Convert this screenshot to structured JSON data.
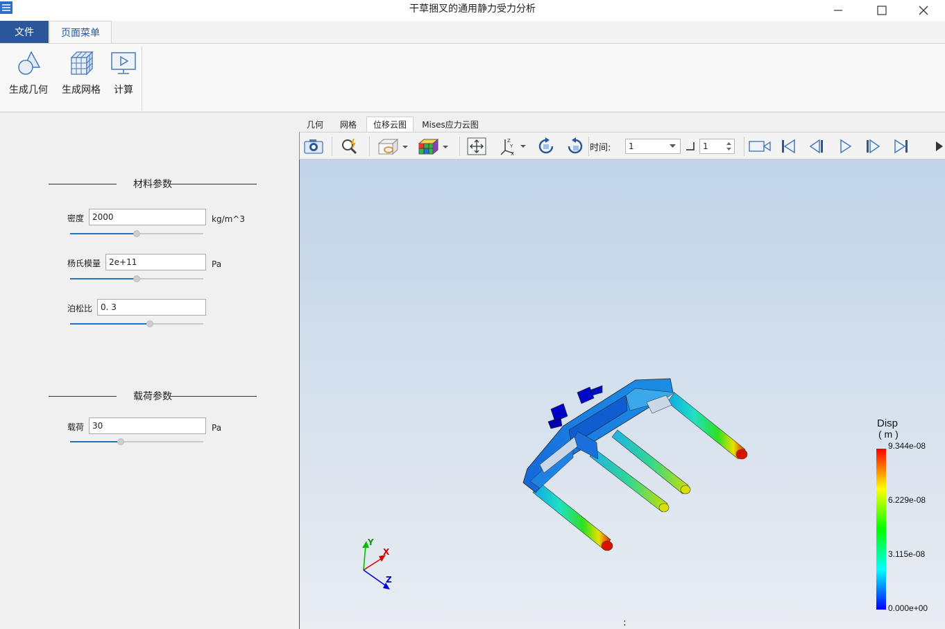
{
  "window": {
    "title": "干草捆叉的通用静力受力分析",
    "app_icon": "app-logo-icon",
    "controls": [
      "minimize-icon",
      "maximize-icon",
      "close-icon"
    ]
  },
  "ribbon": {
    "tabs": [
      {
        "label": "文件",
        "active": false
      },
      {
        "label": "页面菜单",
        "active": true
      }
    ],
    "buttons": [
      {
        "label": "生成几何",
        "icon": "geometry-icon"
      },
      {
        "label": "生成网格",
        "icon": "mesh-icon"
      },
      {
        "label": "计算",
        "icon": "compute-icon"
      }
    ]
  },
  "material_section": {
    "title": "材料参数",
    "params": [
      {
        "label": "密度",
        "value": "2000",
        "unit": "kg/m^3",
        "slider_fraction": 0.5
      },
      {
        "label": "杨氏模量",
        "value": "2e+11",
        "unit": "Pa",
        "slider_fraction": 0.5
      },
      {
        "label": "泊松比",
        "value": "0. 3",
        "unit": "",
        "slider_fraction": 0.6
      }
    ]
  },
  "load_section": {
    "title": "载荷参数",
    "params": [
      {
        "label": "载荷",
        "value": "30",
        "unit": "Pa",
        "slider_fraction": 0.38
      }
    ]
  },
  "viewer": {
    "tabs": [
      {
        "label": "几何",
        "active": false
      },
      {
        "label": "网格",
        "active": false
      },
      {
        "label": "位移云图",
        "active": true
      },
      {
        "label": "Mises应力云图",
        "active": false
      }
    ],
    "toolbar": {
      "time_label": "时间:",
      "time_value": "1",
      "step_value": "1",
      "icons": [
        "camera-icon",
        "zoom-icon",
        "view-box-icon",
        "colormap-cube-icon",
        "pan-icon",
        "axes-icon",
        "rotate-cw-icon",
        "rotate-ccw-icon",
        "record-icon",
        "first-frame-icon",
        "prev-frame-icon",
        "play-icon",
        "next-frame-icon",
        "last-frame-icon"
      ]
    },
    "legend": {
      "title_line1": "Disp",
      "title_line2": "( m )",
      "max": "9.344e-08",
      "v2": "6.229e-08",
      "v1": "3.115e-08",
      "min": "0.000e+00",
      "colors": [
        "#0000ff",
        "#00ffff",
        "#00ff00",
        "#ffff00",
        "#ff0000"
      ]
    },
    "axes": {
      "x": "X",
      "y": "Y",
      "z": "Z"
    }
  }
}
